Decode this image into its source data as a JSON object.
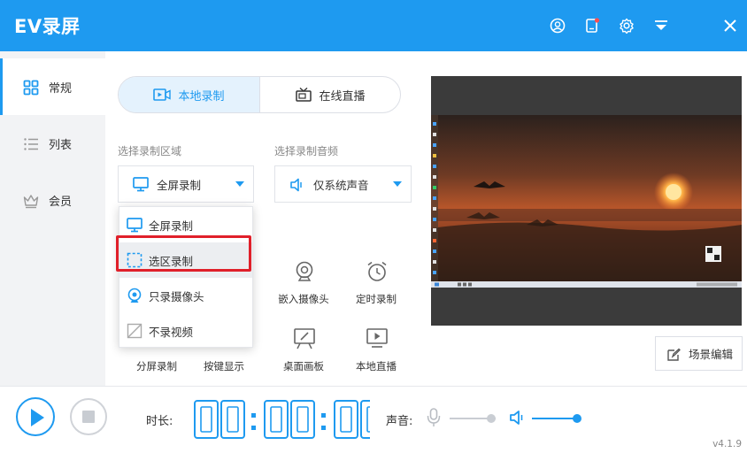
{
  "app": {
    "title": "EV录屏",
    "version": "v4.1.9",
    "accent": "#1e9af0"
  },
  "sidebar": {
    "items": [
      {
        "label": "常规",
        "icon": "grid-icon",
        "active": true
      },
      {
        "label": "列表",
        "icon": "list-icon",
        "active": false
      },
      {
        "label": "会员",
        "icon": "crown-icon",
        "active": false
      }
    ]
  },
  "tabs": [
    {
      "label": "本地录制",
      "icon": "local-record-icon",
      "active": true
    },
    {
      "label": "在线直播",
      "icon": "tv-icon",
      "active": false
    }
  ],
  "region": {
    "label": "选择录制区域",
    "selected": "全屏录制",
    "options": [
      {
        "label": "全屏录制",
        "icon": "monitor-icon"
      },
      {
        "label": "选区录制",
        "icon": "region-select-icon",
        "highlighted": true
      },
      {
        "label": "只录摄像头",
        "icon": "webcam-icon"
      },
      {
        "label": "不录视频",
        "icon": "no-video-icon"
      }
    ]
  },
  "audio": {
    "label": "选择录制音频",
    "selected": "仅系统声音"
  },
  "tools": {
    "embed_camera": "嵌入摄像头",
    "timed_record": "定时录制",
    "split_screen": "分屏录制",
    "key_display": "按键显示",
    "desktop_board": "桌面画板",
    "local_live": "本地直播"
  },
  "scene_edit": "场景编辑",
  "footer": {
    "duration_label": "时长:",
    "time": [
      "00",
      "00",
      "00"
    ],
    "sound_label": "声音:",
    "mic_level": 0.9,
    "speaker_level": 0.95
  }
}
